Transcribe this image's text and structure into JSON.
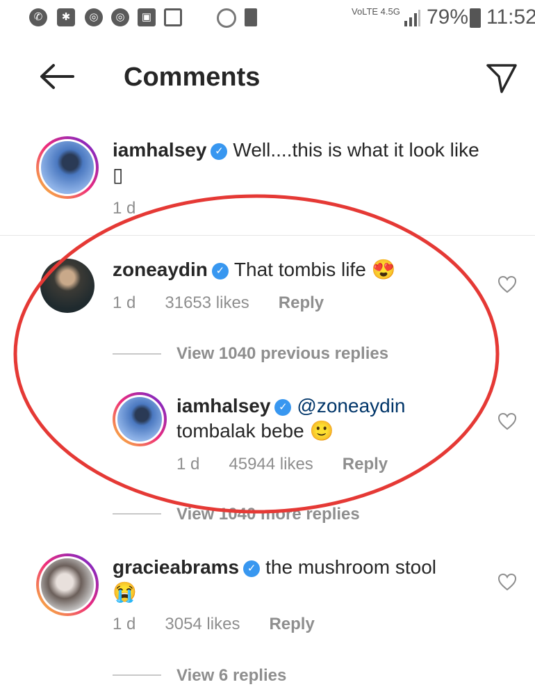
{
  "status_bar": {
    "icons": [
      "whatsapp-icon",
      "bug-icon",
      "chrome-icon",
      "chrome-icon",
      "picture-icon",
      "file-icon",
      "target-icon",
      "sd-card-icon"
    ],
    "network": "VoLTE 4.5G",
    "battery": "79%",
    "time": "11:52"
  },
  "header": {
    "title": "Comments",
    "back_icon": "arrow-left-icon",
    "send_icon": "paper-plane-icon"
  },
  "caption": {
    "username": "iamhalsey",
    "text": "Well....this is what it look like ▯",
    "time": "1 d"
  },
  "comments": [
    {
      "username": "zoneaydin",
      "text": "That tombis life 😍",
      "time": "1 d",
      "likes": "31653 likes",
      "reply": "Reply",
      "view_replies": "View 1040 previous replies",
      "reply_item": {
        "username": "iamhalsey",
        "mention": "@zoneaydin",
        "text": "tombalak bebe 🙂",
        "time": "1 d",
        "likes": "45944 likes",
        "reply": "Reply"
      },
      "view_more": "View 1040 more replies"
    },
    {
      "username": "gracieabrams",
      "text": "the mushroom stool",
      "emoji": "😭",
      "time": "1 d",
      "likes": "3054 likes",
      "reply": "Reply",
      "view_replies": "View 6 replies"
    }
  ],
  "colors": {
    "annotation_oval": "#e53935",
    "verified": "#3897f0",
    "mention": "#003569",
    "secondary_text": "#8e8e8e"
  }
}
